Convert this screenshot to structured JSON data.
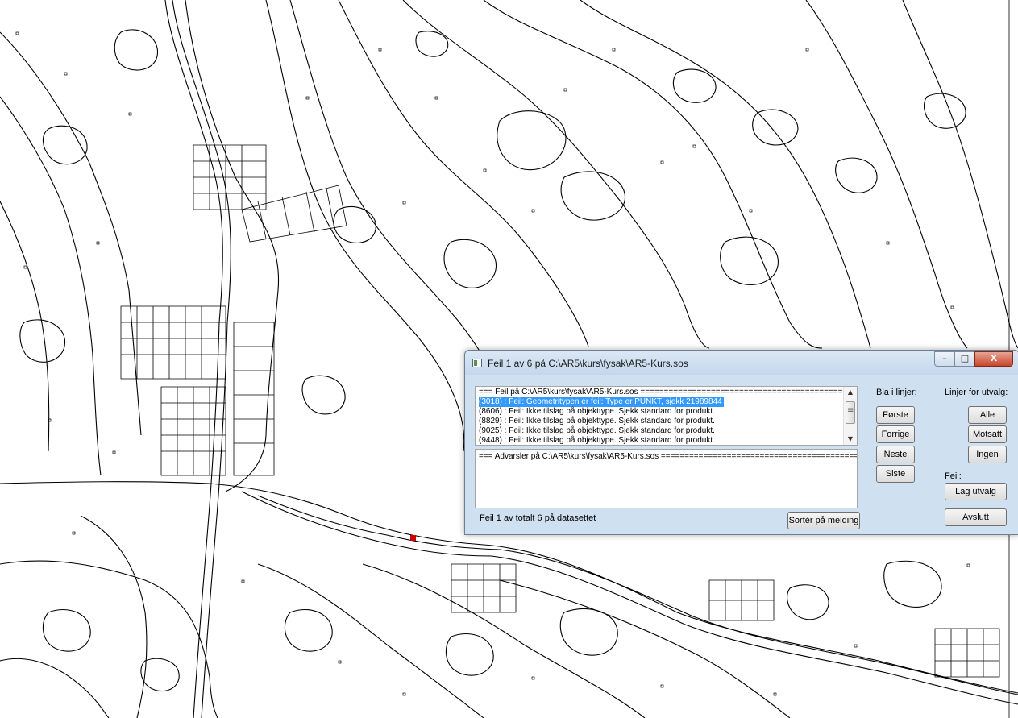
{
  "dialog": {
    "title": "Feil 1 av 6 på C:\\AR5\\kurs\\fysak\\AR5-Kurs.sos",
    "window_buttons": {
      "minimize": "–",
      "maximize": "□",
      "close": "X"
    },
    "error_list": {
      "rows": [
        "===  Feil på C:\\AR5\\kurs\\fysak\\AR5-Kurs.sos  ============================================",
        "(3018) : Feil: Geometritypen er feil: Type er PUNKT, sjekk 21989844",
        "(8606) : Feil: Ikke tilslag på objekttype. Sjekk standard for produkt.",
        "(8829) : Feil: Ikke tilslag på objekttype. Sjekk standard for produkt.",
        "(9025) : Feil: Ikke tilslag på objekttype. Sjekk standard for produkt.",
        "(9448) : Feil: Ikke tilslag på objekttype. Sjekk standard for produkt."
      ],
      "selected_index": 1
    },
    "warning_list": {
      "rows": [
        "===  Advarsler på C:\\AR5\\kurs\\fysak\\AR5-Kurs.sos  =========================================="
      ]
    },
    "browse": {
      "label": "Bla i linjer:",
      "first": "Første",
      "previous": "Forrige",
      "next": "Neste",
      "last": "Siste"
    },
    "selection": {
      "label": "Linjer for utvalg:",
      "all": "Alle",
      "invert": "Motsatt",
      "none": "Ingen"
    },
    "error_section": {
      "label": "Feil:",
      "make_selection": "Lag utvalg"
    },
    "status": "Feil 1 av totalt 6 på datasettet",
    "sort_button": "Sortér på melding",
    "exit_button": "Avslutt"
  },
  "colors": {
    "selection": "#3399ff",
    "marker": "#cc0000",
    "map_lines": "#000000",
    "dialog_frame": "#cfe0f0"
  }
}
